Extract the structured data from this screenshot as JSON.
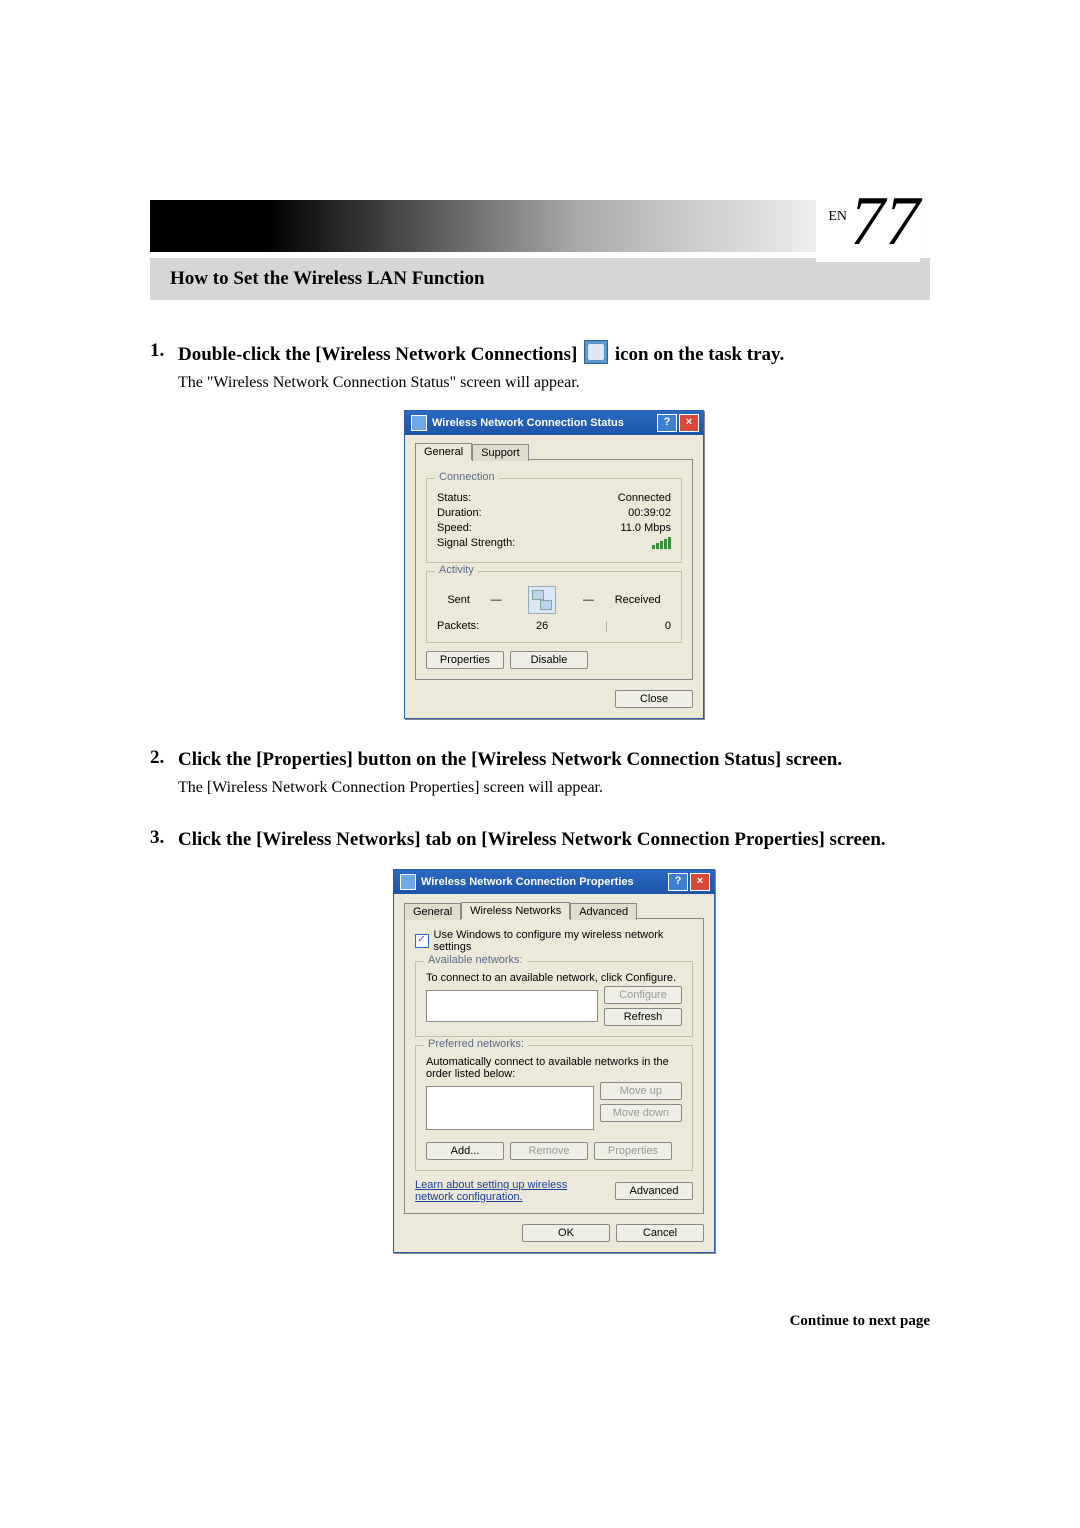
{
  "page": {
    "en_label": "EN",
    "number": "77"
  },
  "section_title": "How to Set the Wireless LAN Function",
  "steps": [
    {
      "heading_pre": "Double-click the [Wireless Network Connections] ",
      "heading_post": " icon on the task tray.",
      "sub": "The \"Wireless Network Connection Status\" screen will appear."
    },
    {
      "heading": "Click the [Properties] button on the [Wireless Network Connection Status] screen.",
      "sub": "The [Wireless Network Connection Properties] screen will appear."
    },
    {
      "heading": "Click the [Wireless Networks] tab on [Wireless Network Connection Properties] screen."
    }
  ],
  "status_dialog": {
    "title": "Wireless Network Connection Status",
    "tabs": {
      "general": "General",
      "support": "Support"
    },
    "connection": {
      "legend": "Connection",
      "status_label": "Status:",
      "status_value": "Connected",
      "duration_label": "Duration:",
      "duration_value": "00:39:02",
      "speed_label": "Speed:",
      "speed_value": "11.0 Mbps",
      "signal_label": "Signal Strength:"
    },
    "activity": {
      "legend": "Activity",
      "sent": "Sent",
      "received": "Received",
      "packets_label": "Packets:",
      "packets_sent": "26",
      "packets_received": "0"
    },
    "buttons": {
      "properties": "Properties",
      "disable": "Disable",
      "close": "Close"
    }
  },
  "props_dialog": {
    "title": "Wireless Network Connection Properties",
    "tabs": {
      "general": "General",
      "wireless": "Wireless Networks",
      "advanced": "Advanced"
    },
    "use_windows": "Use Windows to configure my wireless network settings",
    "available": {
      "legend": "Available networks:",
      "desc": "To connect to an available network, click Configure.",
      "configure": "Configure",
      "refresh": "Refresh"
    },
    "preferred": {
      "legend": "Preferred networks:",
      "desc": "Automatically connect to available networks in the order listed below:",
      "move_up": "Move up",
      "move_down": "Move down",
      "add": "Add...",
      "remove": "Remove",
      "properties": "Properties"
    },
    "learn_text": "Learn about setting up wireless network configuration.",
    "advanced_btn": "Advanced",
    "ok": "OK",
    "cancel": "Cancel"
  },
  "continue_text": "Continue to next page"
}
